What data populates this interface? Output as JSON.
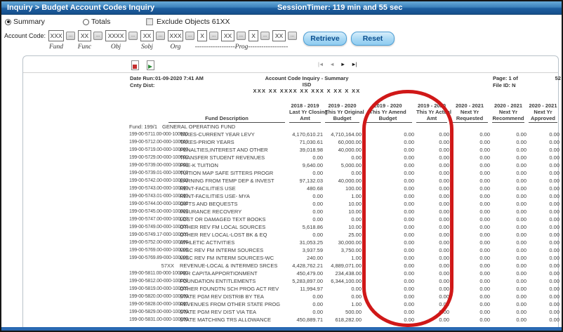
{
  "titlebar": {
    "breadcrumb": "Inquiry > Budget Account Codes Inquiry",
    "session_timer": "SessionTimer: 119 min and 55 sec"
  },
  "filters": {
    "summary_label": "Summary",
    "summary_selected": true,
    "totals_label": "Totals",
    "totals_selected": false,
    "exclude_label": "Exclude Objects 61XX",
    "exclude_checked": false,
    "account_code_label": "Account Code:",
    "ellipsis_label": "...",
    "segments": [
      {
        "name": "fund",
        "value": "XXX",
        "label": "Fund"
      },
      {
        "name": "func",
        "value": "XX",
        "label": "Func"
      },
      {
        "name": "obj",
        "value": "XXXX",
        "label": "Obj"
      },
      {
        "name": "sobj",
        "value": "XX",
        "label": "Sobj"
      },
      {
        "name": "org",
        "value": "XXX",
        "label": "Org"
      },
      {
        "name": "prog-1",
        "value": "X",
        "label": ""
      },
      {
        "name": "prog-2",
        "value": "XX",
        "label": ""
      },
      {
        "name": "prog-3",
        "value": "X",
        "label": ""
      },
      {
        "name": "prog-4",
        "value": "XX",
        "label": ""
      }
    ],
    "prog_label": "------------------Prog------------------",
    "retrieve_label": "Retrieve",
    "reset_label": "Reset"
  },
  "report": {
    "toolbar": {
      "pdf_icon": "pdf-export-icon",
      "csv_icon": "csv-export-icon",
      "nav_first": "|◄",
      "nav_prev": "◄",
      "nav_next": "►",
      "nav_last": "►|"
    },
    "meta": {
      "date_run_label": "Date Run:",
      "date_run": "01-09-2020 7:41 AM",
      "cnty_dist_label": "Cnty Dist:",
      "title": "Account Code Inquiry - Summary",
      "district": "ISD",
      "mask": "XXX XX XXXX XX XXX X XX X XX",
      "page_label": "Page: 1 of",
      "page_total": "52",
      "file_id": "File ID: N"
    },
    "columns": [
      {
        "key": "account",
        "lines": []
      },
      {
        "key": "fund-description",
        "lines": [
          "Fund Description"
        ]
      },
      {
        "key": "last-yr-closing",
        "lines": [
          "2018 - 2019",
          "Last Yr Closing",
          "Amt"
        ]
      },
      {
        "key": "this-yr-original",
        "lines": [
          "2019 - 2020",
          "This Yr Original",
          "Budget"
        ]
      },
      {
        "key": "this-yr-amend",
        "lines": [
          "2019 - 2020",
          "This Yr Amend",
          "Budget"
        ]
      },
      {
        "key": "this-yr-actual",
        "lines": [
          "2019 - 2020",
          "This Yr Actual",
          "Amt"
        ]
      },
      {
        "key": "next-yr-requested",
        "lines": [
          "2020 - 2021",
          "Next Yr",
          "Requested"
        ]
      },
      {
        "key": "next-yr-recommend",
        "lines": [
          "2020 - 2021",
          "Next Yr",
          "Recommend"
        ]
      },
      {
        "key": "next-yr-approved",
        "lines": [
          "2020 - 2021",
          "Next Yr",
          "Approved"
        ]
      }
    ],
    "fund_group": {
      "label": "Fund: 199/1",
      "name": "GENERAL OPERATING FUND"
    },
    "rows": [
      {
        "account": "199-00-5711.00-000-100000",
        "description": "TAXES-CURRENT YEAR LEVY",
        "values": [
          "4,170,610.21",
          "4,710,164.00",
          "0.00",
          "0.00",
          "0.00",
          "0.00",
          "0.00"
        ],
        "is_subtotal": false
      },
      {
        "account": "199-00-5712.00-000-100000",
        "description": "TAXES-PRIOR YEARS",
        "values": [
          "71,030.61",
          "60,000.00",
          "0.00",
          "0.00",
          "0.00",
          "0.00",
          "0.00"
        ],
        "is_subtotal": false
      },
      {
        "account": "199-00-5719.00-000-100000",
        "description": "PENALTIES,INTEREST AND OTHER",
        "values": [
          "39,018.98",
          "40,000.00",
          "0.00",
          "0.00",
          "0.00",
          "0.00",
          "0.00"
        ],
        "is_subtotal": false
      },
      {
        "account": "199-00-5729.00-000-100000",
        "description": "TRANSFER STUDENT REVENUES",
        "values": [
          "0.00",
          "0.00",
          "0.00",
          "0.00",
          "0.00",
          "0.00",
          "0.00"
        ],
        "is_subtotal": false
      },
      {
        "account": "199-00-5739.00-000-100000",
        "description": "PRE-K TUITION",
        "values": [
          "9,640.00",
          "5,000.00",
          "0.00",
          "0.00",
          "0.00",
          "0.00",
          "0.00"
        ],
        "is_subtotal": false
      },
      {
        "account": "199-00-5739.01-000-100000",
        "description": "TUITION MAP SAFE SITTERS PROGR",
        "values": [
          "0.00",
          "0.00",
          "0.00",
          "0.00",
          "0.00",
          "0.00",
          "0.00"
        ],
        "is_subtotal": false
      },
      {
        "account": "199-00-5742.00-000-100000",
        "description": "EARNING FROM TEMP DEP & INVEST",
        "values": [
          "97,132.03",
          "40,000.00",
          "0.00",
          "0.00",
          "0.00",
          "0.00",
          "0.00"
        ],
        "is_subtotal": false
      },
      {
        "account": "199-00-5743.00-000-100000",
        "description": "RENT-FACILITIES USE",
        "values": [
          "480.68",
          "100.00",
          "0.00",
          "0.00",
          "0.00",
          "0.00",
          "0.00"
        ],
        "is_subtotal": false
      },
      {
        "account": "199-00-5743.01-000-100000",
        "description": "RENT-FACILITIES USE- MYA",
        "values": [
          "0.00",
          "1.00",
          "0.00",
          "0.00",
          "0.00",
          "0.00",
          "0.00"
        ],
        "is_subtotal": false
      },
      {
        "account": "199-00-5744.00-000-100000",
        "description": "GIFTS AND BEQUESTS",
        "values": [
          "0.00",
          "10.00",
          "0.00",
          "0.00",
          "0.00",
          "0.00",
          "0.00"
        ],
        "is_subtotal": false
      },
      {
        "account": "199-00-5745.00-000-100000",
        "description": "INSURANCE RECOVERY",
        "values": [
          "0.00",
          "10.00",
          "0.00",
          "0.00",
          "0.00",
          "0.00",
          "0.00"
        ],
        "is_subtotal": false
      },
      {
        "account": "199-00-5747.00-000-100000",
        "description": "LOST OR DAMAGED TEXT BOOKS",
        "values": [
          "0.00",
          "0.00",
          "0.00",
          "0.00",
          "0.00",
          "0.00",
          "0.00"
        ],
        "is_subtotal": false
      },
      {
        "account": "199-00-5749.00-000-100000",
        "description": "OTHER REV FM LOCAL SOURCES",
        "values": [
          "5,618.86",
          "10.00",
          "0.00",
          "0.00",
          "0.00",
          "0.00",
          "0.00"
        ],
        "is_subtotal": false
      },
      {
        "account": "199-00-5749.17-000-100000",
        "description": "OTHER REV LOCAL-LOST BK & EQ",
        "values": [
          "0.00",
          "25.00",
          "0.00",
          "0.00",
          "0.00",
          "0.00",
          "0.00"
        ],
        "is_subtotal": false
      },
      {
        "account": "199-00-5752.00-000-100000",
        "description": "ATHLETIC ACTIVITIES",
        "values": [
          "31,053.25",
          "30,000.00",
          "0.00",
          "0.00",
          "0.00",
          "0.00",
          "0.00"
        ],
        "is_subtotal": false
      },
      {
        "account": "199-00-5769.00-000-100000",
        "description": "MISC REV FM INTERM SOURCES",
        "values": [
          "3,937.59",
          "3,750.00",
          "0.00",
          "0.00",
          "0.00",
          "0.00",
          "0.00"
        ],
        "is_subtotal": false
      },
      {
        "account": "199-00-5769.89-000-100000",
        "description": "MISC REV FM INTERM SOURCES-WC",
        "values": [
          "240.00",
          "1.00",
          "0.00",
          "0.00",
          "0.00",
          "0.00",
          "0.00"
        ],
        "is_subtotal": false
      },
      {
        "account": "57XX",
        "description": "REVENUE-LOCAL & INTERMED SRCES",
        "values": [
          "4,428,762.21",
          "4,889,071.00",
          "0.00",
          "0.00",
          "0.00",
          "0.00",
          "0.00"
        ],
        "is_subtotal": true
      },
      {
        "account": "199-00-5811.00-000-100000",
        "description": "PER CAPITA APPORTIONMENT",
        "values": [
          "450,479.00",
          "234,438.00",
          "0.00",
          "0.00",
          "0.00",
          "0.00",
          "0.00"
        ],
        "is_subtotal": false
      },
      {
        "account": "199-00-5812.00-000-100000",
        "description": "FOUNDATION ENTITLEMENTS",
        "values": [
          "5,283,897.00",
          "6,344,100.00",
          "0.00",
          "0.00",
          "0.00",
          "0.00",
          "0.00"
        ],
        "is_subtotal": false
      },
      {
        "account": "199-00-5819.00-000-100000",
        "description": "OTHER FOUNDTN SCH PROG ACT REV",
        "values": [
          "11,994.97",
          "0.00",
          "0.00",
          "0.00",
          "0.00",
          "0.00",
          "0.00"
        ],
        "is_subtotal": false
      },
      {
        "account": "199-00-5820.00-000-100000",
        "description": "STATE PGM REV DISTRIB BY TEA",
        "values": [
          "0.00",
          "0.00",
          "0.00",
          "0.00",
          "0.00",
          "0.00",
          "0.00"
        ],
        "is_subtotal": false
      },
      {
        "account": "199-00-5828.00-000-100000",
        "description": "REVENUES FROM OTHER STATE PROG",
        "values": [
          "0.00",
          "1.00",
          "0.00",
          "0.00",
          "0.00",
          "0.00",
          "0.00"
        ],
        "is_subtotal": false
      },
      {
        "account": "199-00-5829.00-000-100000",
        "description": "STATE PGM REV DIST VIA TEA",
        "values": [
          "0.00",
          "500.00",
          "0.00",
          "0.00",
          "0.00",
          "0.00",
          "0.00"
        ],
        "is_subtotal": false
      },
      {
        "account": "199-00-5831.00-000-100000",
        "description": "STATE MATCHING TRS ALLOWANCE",
        "values": [
          "450,889.71",
          "618,282.00",
          "0.00",
          "0.00",
          "0.00",
          "0.00",
          "0.00"
        ],
        "is_subtotal": false
      }
    ]
  },
  "annotation": {
    "shape": "oval",
    "color": "#d01818",
    "circled_columns": [
      "This Yr Amend Budget",
      "This Yr Actual Amt"
    ]
  },
  "colors": {
    "titlebar_top": "#68aad9",
    "titlebar_bottom": "#164f8c",
    "button_face": "#a8d8f4",
    "button_border": "#4d9fd6",
    "button_text": "#0b4f8f",
    "panel_border": "#b9c2c9",
    "annotation_red": "#d01818",
    "bottom_strip_blue": "#2a69b2"
  }
}
